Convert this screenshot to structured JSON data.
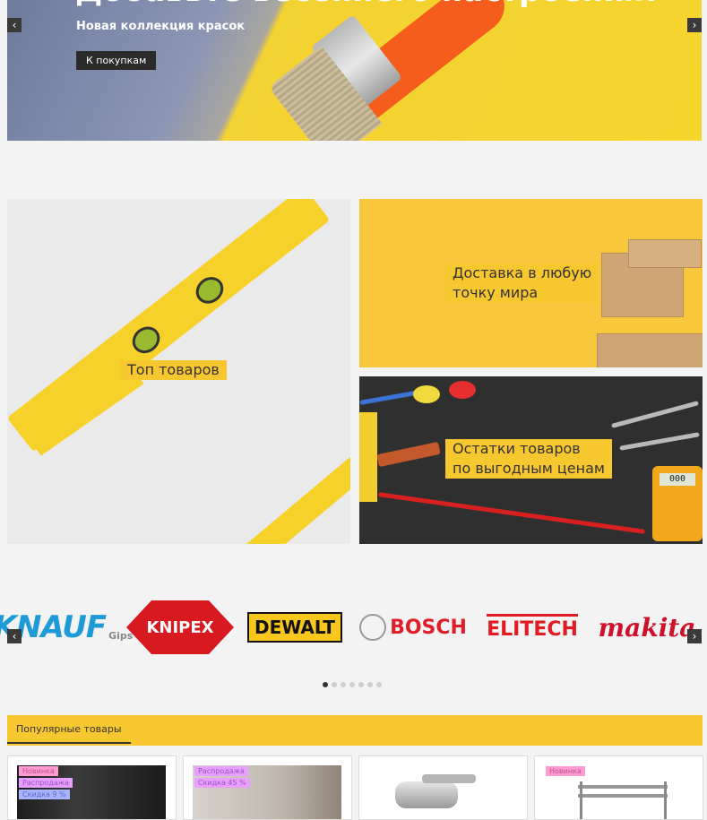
{
  "hero": {
    "title": "Добавьте весеннего настроения!",
    "subtitle": "Новая коллекция красок",
    "cta_label": "К покупкам",
    "prev_icon": "‹",
    "next_icon": "›"
  },
  "banners": {
    "top_products": "Топ товаров",
    "delivery_line1": "Доставка в любую",
    "delivery_line2": "точку мира",
    "stock_line1": "Остатки товаров",
    "stock_line2": "по выгодным ценам"
  },
  "brands": {
    "items": [
      "KNAUF",
      "Gips",
      "KNIPEX",
      "DEWALT",
      "BOSCH",
      "ELITECH",
      "makita"
    ],
    "prev_icon": "‹",
    "next_icon": "›",
    "dots_count": 7,
    "active_dot": 0
  },
  "popular": {
    "tab_label": "Популярные товары",
    "products": [
      {
        "badges": [
          "Новинка",
          "Распродажа",
          "Скидка 9 %"
        ]
      },
      {
        "badges": [
          "Распродажа",
          "Скидка 45 %"
        ]
      },
      {
        "badges": []
      },
      {
        "badges": [
          "Новинка"
        ]
      }
    ]
  },
  "colors": {
    "accent_yellow": "#f7c72f",
    "dark": "#2b2b2b",
    "knauf_blue": "#1e9ad6",
    "knipex_red": "#d71920",
    "makita_red": "#d0102a"
  }
}
